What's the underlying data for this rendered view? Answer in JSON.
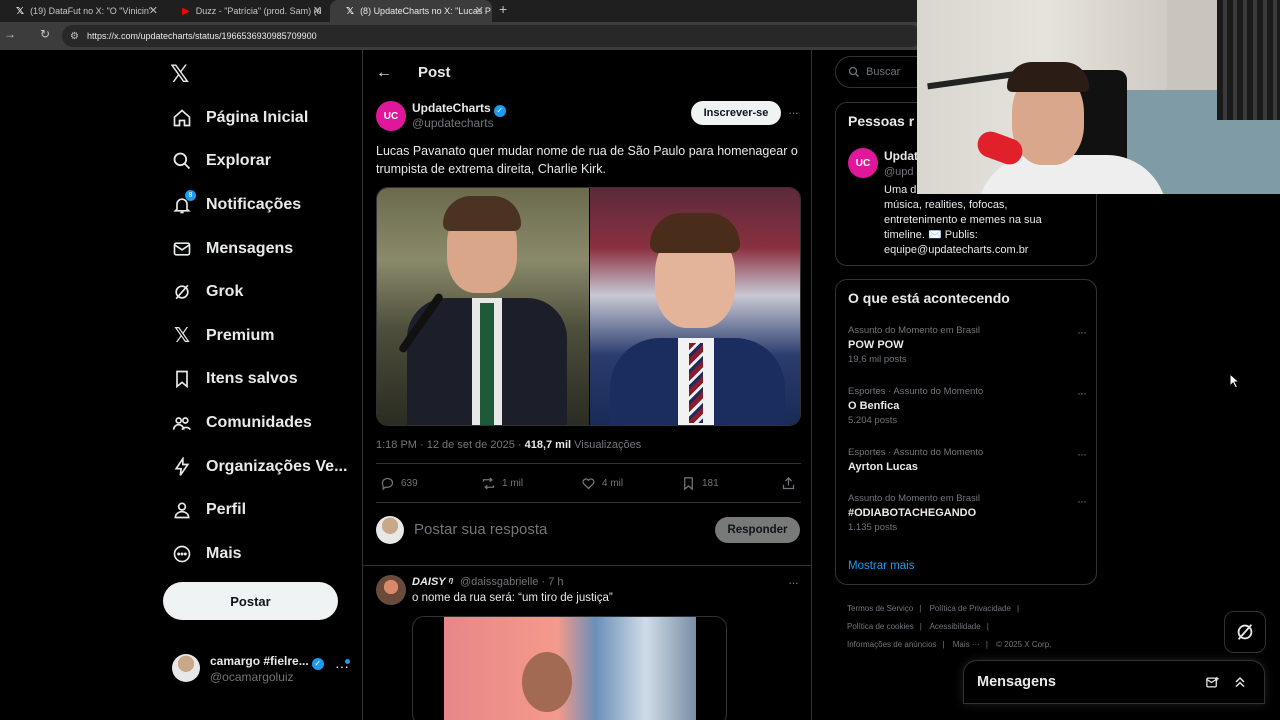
{
  "browser": {
    "tabs": [
      {
        "icon": "x-logo-icon",
        "label": "(19) DataFut no X: \"O \"Vinicin\""
      },
      {
        "icon": "youtube-icon",
        "label": "Duzz - \"Patrícia\" (prod. Sam) (d"
      },
      {
        "icon": "x-logo-icon",
        "label": "(8) UpdateCharts no X: \"Lucas P"
      }
    ],
    "url": "https://x.com/updatecharts/status/1966536930985709900"
  },
  "sidebar": {
    "items": [
      {
        "label": "Página Inicial",
        "icon": "home-icon"
      },
      {
        "label": "Explorar",
        "icon": "search-icon"
      },
      {
        "label": "Notificações",
        "icon": "bell-icon",
        "badge": "8"
      },
      {
        "label": "Mensagens",
        "icon": "mail-icon"
      },
      {
        "label": "Grok",
        "icon": "grok-icon"
      },
      {
        "label": "Premium",
        "icon": "x-logo-icon"
      },
      {
        "label": "Itens salvos",
        "icon": "bookmark-icon"
      },
      {
        "label": "Comunidades",
        "icon": "communities-icon"
      },
      {
        "label": "Organizações Ve...",
        "icon": "lightning-icon"
      },
      {
        "label": "Perfil",
        "icon": "person-icon"
      },
      {
        "label": "Mais",
        "icon": "more-circle-icon"
      }
    ],
    "post_button": "Postar",
    "account": {
      "name": "camargo #fielre...",
      "handle": "@ocamargoluiz"
    }
  },
  "main": {
    "header_title": "Post",
    "tweet": {
      "avatar_text": "UC",
      "author": "UpdateCharts",
      "handle": "@updatecharts",
      "subscribe": "Inscrever-se",
      "text": "Lucas Pavanato quer mudar nome de rua de São Paulo para homenagear o trumpista de extrema direita, Charlie Kirk.",
      "time": "1:18 PM · 12 de set de 2025 · ",
      "views_count": "418,7 mil",
      "views_label": " Visualizações",
      "replies": "639",
      "reposts": "1 mil",
      "likes": "4 mil",
      "bookmarks": "181"
    },
    "reply_box": {
      "placeholder": "Postar sua resposta",
      "button": "Responder"
    },
    "reply": {
      "name": "DAISY ᵑ",
      "handle": "@daissgabrielle · 7 h",
      "text": "o nome da rua será: “um tiro de justiça”"
    }
  },
  "right": {
    "search_placeholder": "Buscar",
    "people": {
      "title": "Pessoas r",
      "avatar_text": "UC",
      "name": "Updat",
      "handle": "@upd",
      "bio_1": "Uma d",
      "bio_2": "música, realities, fofocas,",
      "bio_3": "entretenimento e memes na sua",
      "bio_4": "timeline. ✉️ Publis:",
      "bio_5": "equipe@updatecharts.com.br"
    },
    "trends": {
      "title": "O que está acontecendo",
      "items": [
        {
          "category": "Assunto do Momento em Brasil",
          "name": "POW POW",
          "count": "19,6 mil posts"
        },
        {
          "category": "Esportes · Assunto do Momento",
          "name": "O Benfica",
          "count": "5.204 posts"
        },
        {
          "category": "Esportes · Assunto do Momento",
          "name": "Ayrton Lucas",
          "count": ""
        },
        {
          "category": "Assunto do Momento em Brasil",
          "name": "#ODIABOTACHEGANDO",
          "count": "1.135 posts"
        }
      ],
      "show_more": "Mostrar mais"
    },
    "footer": {
      "terms": "Termos de Serviço",
      "privacy": "Política de Privacidade",
      "cookies": "Política de cookies",
      "accessibility": "Acessibilidade",
      "ads": "Informações de anúncios",
      "more": "Mais ···",
      "copyright": "© 2025 X Corp."
    }
  },
  "messages_drawer": {
    "title": "Mensagens"
  },
  "colors": {
    "accent": "#1d9bf0",
    "background": "#000000",
    "text": "#e7e9ea",
    "muted": "#71767b",
    "border": "#2f3336",
    "brand_avatar": "#e0179b"
  }
}
